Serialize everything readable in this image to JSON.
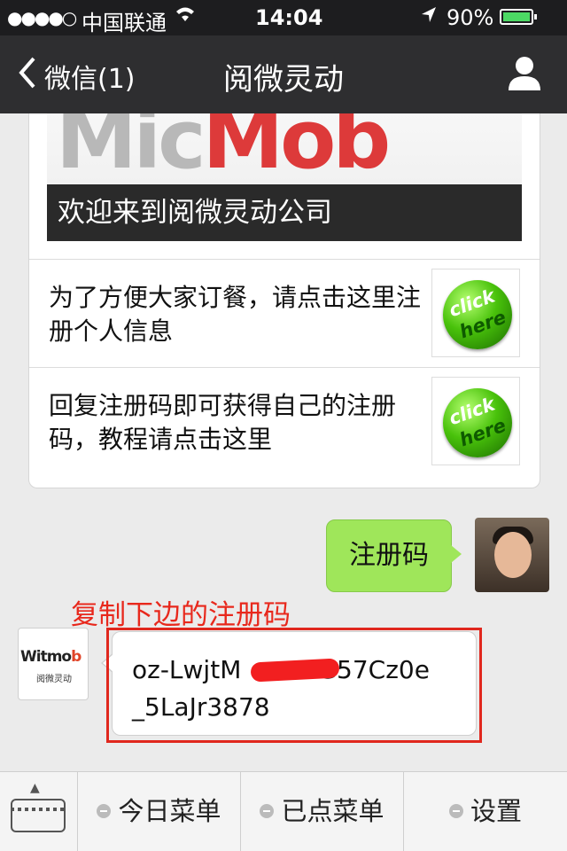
{
  "status_bar": {
    "signal": "●●●●○",
    "carrier": "中国联通",
    "time": "14:04",
    "battery_pct": "90%"
  },
  "nav": {
    "back_label": "微信(1)",
    "title": "阅微灵动"
  },
  "article": {
    "banner_logo_left": "Mic",
    "banner_logo_right": "Mob",
    "banner_caption": "欢迎来到阅微灵动公司",
    "items": [
      {
        "text": "为了方便大家订餐，请点击这里注册个人信息",
        "thumb_word1": "click",
        "thumb_word2": "here"
      },
      {
        "text": "回复注册码即可获得自己的注册码，教程请点击这里",
        "thumb_word1": "click",
        "thumb_word2": "here"
      }
    ]
  },
  "sent_message": "注册码",
  "annotation": "复制下边的注册码",
  "bot": {
    "brand_a": "Witmo",
    "brand_b": "b",
    "brand_sub": "阅微灵动"
  },
  "received_message": "oz-LwjtM      G57Cz0e\n_5LaJr3878",
  "received_line1_a": "oz-LwjtM",
  "received_line1_b": "G57Cz0e",
  "received_line2": "_5LaJr3878",
  "menu": {
    "items": [
      "今日菜单",
      "已点菜单",
      "设置"
    ]
  },
  "colors": {
    "accent_green": "#9fe65a",
    "annotation_red": "#e8281c",
    "navbar": "#2e2e30"
  }
}
